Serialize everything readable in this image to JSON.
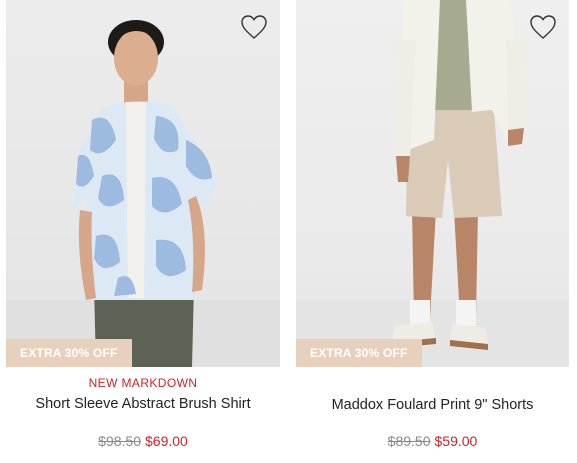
{
  "products": [
    {
      "badge": "EXTRA 30% OFF",
      "flag": "NEW MARKDOWN",
      "name": "Short Sleeve Abstract Brush Shirt",
      "original_price": "$98.50",
      "sale_price": "$69.00",
      "wishlist_icon": "heart-outline-icon"
    },
    {
      "badge": "EXTRA 30% OFF",
      "flag": "",
      "name": "Maddox Foulard Print 9\" Shorts",
      "original_price": "$89.50",
      "sale_price": "$59.00",
      "wishlist_icon": "heart-outline-icon"
    }
  ],
  "colors": {
    "sale_red": "#d42026",
    "badge_bg": "#e7d1bd",
    "strike_gray": "#8a8a8a"
  }
}
